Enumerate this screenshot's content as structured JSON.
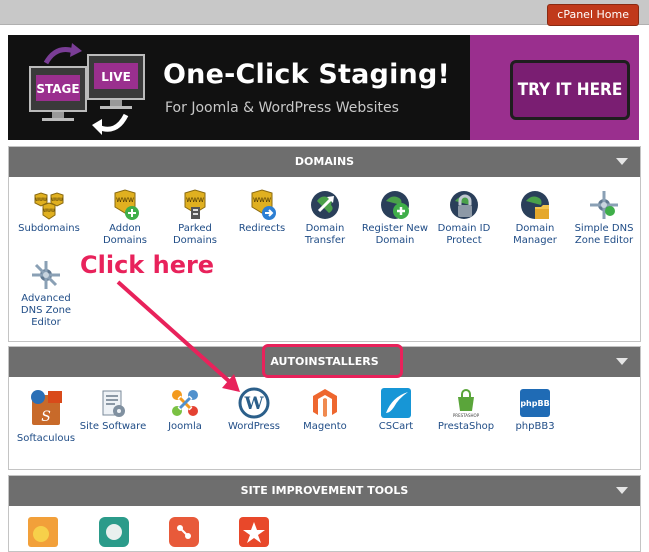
{
  "header": {
    "cpanel_home": "cPanel Home"
  },
  "banner": {
    "stage_label": "STAGE",
    "live_label": "LIVE",
    "headline": "One-Click Staging!",
    "subheadline": "For Joomla & WordPress Websites",
    "cta": "TRY IT HERE"
  },
  "sections": {
    "domains": {
      "title": "DOMAINS",
      "items": [
        {
          "label": "Subdomains",
          "icon": "subdomains-icon"
        },
        {
          "label": "Addon Domains",
          "icon": "addon-domains-icon"
        },
        {
          "label": "Parked Domains",
          "icon": "parked-domains-icon"
        },
        {
          "label": "Redirects",
          "icon": "redirects-icon"
        },
        {
          "label": "Domain Transfer",
          "icon": "domain-transfer-icon"
        },
        {
          "label": "Register New Domain",
          "icon": "register-domain-icon"
        },
        {
          "label": "Domain ID Protect",
          "icon": "domain-id-protect-icon"
        },
        {
          "label": "Domain Manager",
          "icon": "domain-manager-icon"
        },
        {
          "label": "Simple DNS Zone Editor",
          "icon": "simple-dns-icon"
        },
        {
          "label": "Advanced DNS Zone Editor",
          "icon": "advanced-dns-icon"
        }
      ]
    },
    "autoinstallers": {
      "title": "AUTOINSTALLERS",
      "items": [
        {
          "label": "Softaculous",
          "icon": "softaculous-icon"
        },
        {
          "label": "Site Software",
          "icon": "site-software-icon"
        },
        {
          "label": "Joomla",
          "icon": "joomla-icon"
        },
        {
          "label": "WordPress",
          "icon": "wordpress-icon"
        },
        {
          "label": "Magento",
          "icon": "magento-icon"
        },
        {
          "label": "CSCart",
          "icon": "cscart-icon"
        },
        {
          "label": "PrestaShop",
          "icon": "prestashop-icon"
        },
        {
          "label": "phpBB3",
          "icon": "phpbb3-icon"
        }
      ]
    },
    "site_improvement": {
      "title": "SITE IMPROVEMENT TOOLS"
    }
  },
  "annotation": {
    "callout": "Click here"
  },
  "colors": {
    "accent": "#e8225b",
    "header_bar": "#6e6e6e",
    "link": "#1f4c86",
    "cta_purple": "#9a2f8e"
  }
}
